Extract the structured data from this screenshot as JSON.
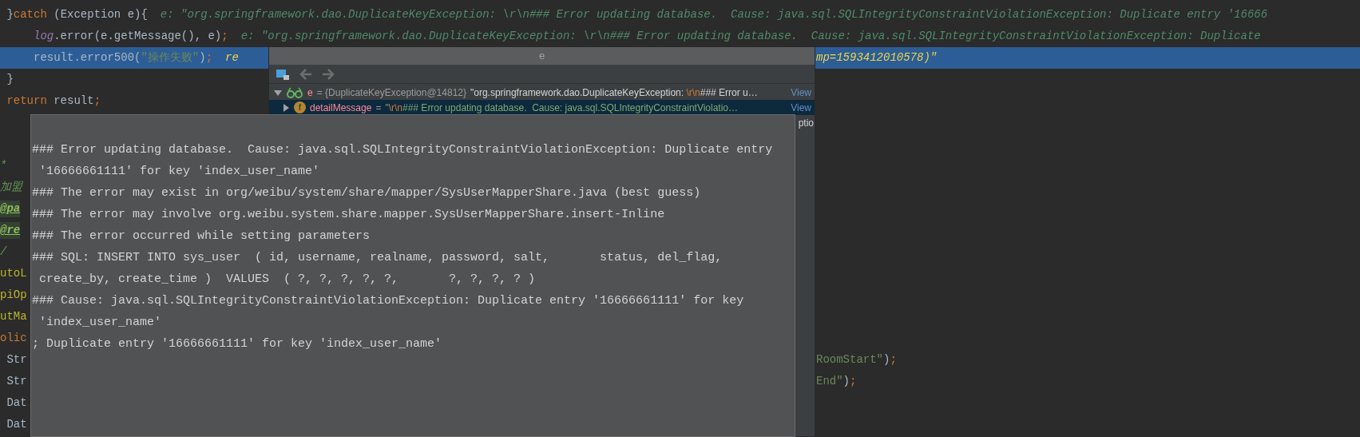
{
  "editor": {
    "lines": [
      {
        "selected": false,
        "tokens": [
          {
            "kind": "plain",
            "text": " }"
          },
          {
            "kind": "keyword",
            "text": "catch"
          },
          {
            "kind": "plain",
            "text": " (Exception e){"
          },
          {
            "kind": "hint",
            "text": "e: \"org.springframework.dao.DuplicateKeyException: \\r\\n### Error updating database.  Cause: java.sql.SQLIntegrityConstraintViolationException: Duplicate entry '16666"
          }
        ]
      },
      {
        "selected": false,
        "tokens": [
          {
            "kind": "field",
            "text": "     log"
          },
          {
            "kind": "plain",
            "text": ".error(e.getMessage(), e)"
          },
          {
            "kind": "keyword",
            "text": ";"
          },
          {
            "kind": "hint",
            "text": "e: \"org.springframework.dao.DuplicateKeyException: \\r\\n### Error updating database.  Cause: java.sql.SQLIntegrityConstraintViolationException: Duplicate"
          }
        ]
      },
      {
        "selected": true,
        "tokens": [
          {
            "kind": "plain",
            "text": "     result.error500("
          },
          {
            "kind": "string",
            "text": "\"操作失败\""
          },
          {
            "kind": "plain",
            "text": ")"
          },
          {
            "kind": "keyword",
            "text": ";"
          },
          {
            "kind": "value",
            "text": "re"
          }
        ],
        "right_tokens": [
          {
            "kind": "value",
            "text": "mp=1593412010578)\""
          }
        ]
      },
      {
        "selected": false,
        "tokens": [
          {
            "kind": "plain",
            "text": " }"
          }
        ]
      },
      {
        "selected": false,
        "tokens": [
          {
            "kind": "keyword",
            "text": " return"
          },
          {
            "kind": "plain",
            "text": " result"
          },
          {
            "kind": "keyword",
            "text": ";"
          }
        ]
      },
      {
        "selected": false
      },
      {
        "selected": false
      },
      {
        "selected": false,
        "tokens": [
          {
            "kind": "doc",
            "text": "*"
          }
        ]
      },
      {
        "selected": false,
        "tokens": [
          {
            "kind": "doc",
            "text": "加盟"
          }
        ]
      },
      {
        "selected": false,
        "tokens": [
          {
            "kind": "tag",
            "text": "@pa"
          }
        ]
      },
      {
        "selected": false,
        "tokens": [
          {
            "kind": "tag",
            "text": "@re"
          }
        ]
      },
      {
        "selected": false,
        "tokens": [
          {
            "kind": "doc",
            "text": "/"
          }
        ]
      },
      {
        "selected": false,
        "tokens": [
          {
            "kind": "annotation",
            "text": "utoL"
          }
        ]
      },
      {
        "selected": false,
        "tokens": [
          {
            "kind": "annotation",
            "text": "piOp"
          }
        ]
      },
      {
        "selected": false,
        "tokens": [
          {
            "kind": "annotation",
            "text": "utMa"
          }
        ]
      },
      {
        "selected": false,
        "tokens": [
          {
            "kind": "keyword",
            "text": "olic"
          }
        ]
      },
      {
        "selected": false,
        "tokens": [
          {
            "kind": "plain",
            "text": " Str"
          }
        ],
        "right_tokens": [
          {
            "kind": "string",
            "text": "RoomStart\""
          },
          {
            "kind": "plain",
            "text": ")"
          },
          {
            "kind": "keyword",
            "text": ";"
          }
        ]
      },
      {
        "selected": false,
        "tokens": [
          {
            "kind": "plain",
            "text": " Str"
          }
        ],
        "right_tokens": [
          {
            "kind": "string",
            "text": "End\""
          },
          {
            "kind": "plain",
            "text": ")"
          },
          {
            "kind": "keyword",
            "text": ";"
          }
        ]
      },
      {
        "selected": false,
        "tokens": [
          {
            "kind": "plain",
            "text": " Dat"
          }
        ]
      },
      {
        "selected": false,
        "tokens": [
          {
            "kind": "plain",
            "text": " Dat"
          }
        ]
      }
    ]
  },
  "debugger": {
    "title": "e",
    "toolbar": [
      {
        "kind": "tree",
        "disabled": false
      },
      {
        "kind": "back",
        "disabled": true
      },
      {
        "kind": "forward",
        "disabled": true
      }
    ],
    "rows": [
      {
        "kind": "watch",
        "expanded": true,
        "selected": false,
        "name": "e",
        "type": "= {DuplicateKeyException@14812}",
        "value": [
          {
            "kind": "text",
            "text": "\"org.springframework.dao.DuplicateKeyException: "
          },
          {
            "kind": "escape",
            "text": "\\r\\n"
          },
          {
            "kind": "text",
            "text": "### Error u…"
          }
        ],
        "link": "View"
      },
      {
        "kind": "field",
        "expanded": false,
        "selected": true,
        "badge": "f",
        "name": "detailMessage",
        "type": "=",
        "value": [
          {
            "kind": "string",
            "text": "\""
          },
          {
            "kind": "escape",
            "text": "\\r\\n"
          },
          {
            "kind": "string",
            "text": "### Error updating database.  Cause: java.sql.SQLIntegrityConstraintViolatio…"
          }
        ],
        "link": "View"
      },
      {
        "kind": "clipped",
        "value": [
          {
            "kind": "text",
            "text": "ptio"
          }
        ]
      }
    ]
  },
  "tooltip": {
    "lines": [
      "### Error updating database.  Cause: java.sql.SQLIntegrityConstraintViolationException: Duplicate entry",
      " '16666661111' for key 'index_user_name'",
      "### The error may exist in org/weibu/system/share/mapper/SysUserMapperShare.java (best guess)",
      "### The error may involve org.weibu.system.share.mapper.SysUserMapperShare.insert-Inline",
      "### The error occurred while setting parameters",
      "### SQL: INSERT INTO sys_user  ( id, username, realname, password, salt,       status, del_flag,",
      " create_by, create_time )  VALUES  ( ?, ?, ?, ?, ?,       ?, ?, ?, ? )",
      "### Cause: java.sql.SQLIntegrityConstraintViolationException: Duplicate entry '16666661111' for key",
      " 'index_user_name'",
      "; Duplicate entry '16666661111' for key 'index_user_name'"
    ]
  }
}
